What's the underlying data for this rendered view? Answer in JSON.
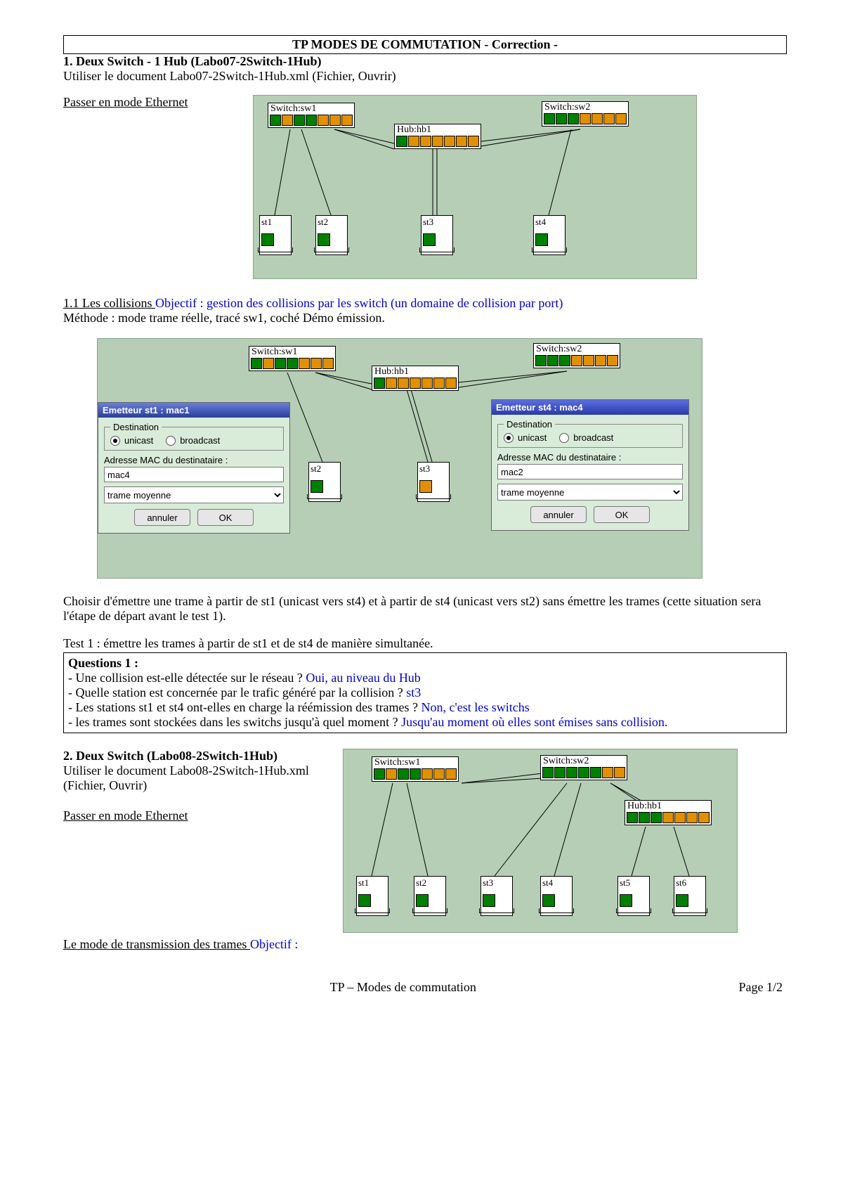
{
  "header": {
    "title": "TP MODES DE COMMUTATION - Correction -"
  },
  "sec1": {
    "head": "1. Deux Switch - 1 Hub (Labo07-2Switch-1Hub)",
    "doc_line": "Utiliser le document Labo07-2Switch-1Hub.xml (Fichier, Ouvrir)",
    "ethernet": "Passer en mode Ethernet"
  },
  "diagram1": {
    "sw1": "Switch:sw1",
    "sw2": "Switch:sw2",
    "hub": "Hub:hb1",
    "st1": "st1",
    "st2": "st2",
    "st3": "st3",
    "st4": "st4"
  },
  "collisions": {
    "under": "1.1 Les collisions ",
    "blue": "Objectif : gestion des collisions par les switch (un domaine de collision par port)",
    "method": "Méthode : mode trame réelle, tracé sw1, coché Démo émission."
  },
  "diagram2": {
    "sw1": "Switch:sw1",
    "sw2": "Switch:sw2",
    "hub": "Hub:hb1",
    "st2": "st2",
    "st3": "st3",
    "dlg1": {
      "title": "Emetteur st1 : mac1",
      "legend": "Destination",
      "r1": "unicast",
      "r2": "broadcast",
      "mac_label": "Adresse MAC du destinataire :",
      "mac": "mac4",
      "frame": "trame moyenne",
      "cancel": "annuler",
      "ok": "OK"
    },
    "dlg2": {
      "title": "Emetteur st4 : mac4",
      "legend": "Destination",
      "r1": "unicast",
      "r2": "broadcast",
      "mac_label": "Adresse MAC du destinataire :",
      "mac": "mac2",
      "frame": "trame moyenne",
      "cancel": "annuler",
      "ok": "OK"
    }
  },
  "choisir": "Choisir d'émettre une trame à partir de st1 (unicast vers st4) et à partir de st4 (unicast vers st2) sans émettre les trames (cette situation sera l'étape de départ avant le test 1).",
  "test1": "Test 1 : émettre les trames à partir de st1 et de st4 de manière simultanée.",
  "q1": {
    "head": "Questions 1 :",
    "l1a": "- Une collision est-elle détectée sur le réseau ? ",
    "l1b": "Oui, au niveau du Hub",
    "l2a": "- Quelle station est concernée par le trafic généré par la collision ? ",
    "l2b": "st3",
    "l3a": "- Les stations st1 et st4 ont-elles en charge la réémission des trames ? ",
    "l3b": "Non, c'est les switchs",
    "l4a": "- les trames sont stockées dans les switchs jusqu'à quel moment ? ",
    "l4b": "Jusqu'au moment où elles sont émises sans collision."
  },
  "sec2": {
    "head": "2. Deux Switch (Labo08-2Switch-1Hub)",
    "doc_line": "Utiliser le document Labo08-2Switch-1Hub.xml (Fichier, Ouvrir)",
    "ethernet": "Passer en mode Ethernet"
  },
  "diagram3": {
    "sw1": "Switch:sw1",
    "sw2": "Switch:sw2",
    "hub": "Hub:hb1",
    "st1": "st1",
    "st2": "st2",
    "st3": "st3",
    "st4": "st4",
    "st5": "st5",
    "st6": "st6"
  },
  "trans": {
    "under": "Le mode de transmission des trames ",
    "blue": " Objectif :"
  },
  "footer": {
    "center": "TP – Modes de commutation",
    "right": "Page 1/2"
  }
}
